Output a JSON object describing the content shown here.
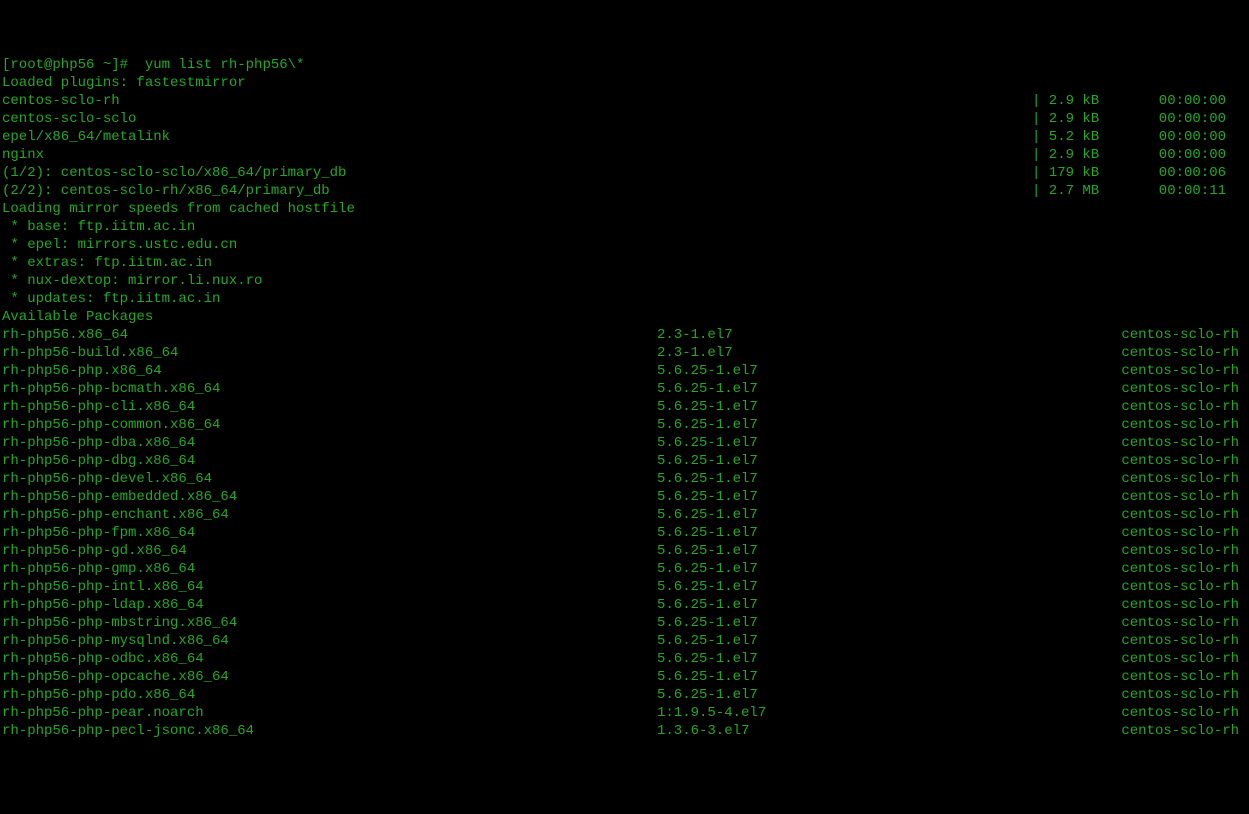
{
  "prompt": "[root@php56 ~]#  yum list rh-php56\\*",
  "loaded": "Loaded plugins: fastestmirror",
  "repos": [
    {
      "name": "centos-sclo-rh",
      "size": "| 2.9 kB",
      "time": "  00:00:00"
    },
    {
      "name": "centos-sclo-sclo",
      "size": "| 2.9 kB",
      "time": "  00:00:00"
    },
    {
      "name": "epel/x86_64/metalink",
      "size": "| 5.2 kB",
      "time": "  00:00:00"
    },
    {
      "name": "nginx",
      "size": "| 2.9 kB",
      "time": "  00:00:00"
    },
    {
      "name": "(1/2): centos-sclo-sclo/x86_64/primary_db",
      "size": "| 179 kB",
      "time": "  00:00:06"
    },
    {
      "name": "(2/2): centos-sclo-rh/x86_64/primary_db",
      "size": "| 2.7 MB",
      "time": "  00:00:11"
    }
  ],
  "loading_mirror": "Loading mirror speeds from cached hostfile",
  "mirrors": [
    " * base: ftp.iitm.ac.in",
    " * epel: mirrors.ustc.edu.cn",
    " * extras: ftp.iitm.ac.in",
    " * nux-dextop: mirror.li.nux.ro",
    " * updates: ftp.iitm.ac.in"
  ],
  "available_header": "Available Packages",
  "packages": [
    {
      "name": "rh-php56.x86_64",
      "ver": "2.3-1.el7",
      "repo": "centos-sclo-rh"
    },
    {
      "name": "rh-php56-build.x86_64",
      "ver": "2.3-1.el7",
      "repo": "centos-sclo-rh"
    },
    {
      "name": "rh-php56-php.x86_64",
      "ver": "5.6.25-1.el7",
      "repo": "centos-sclo-rh"
    },
    {
      "name": "rh-php56-php-bcmath.x86_64",
      "ver": "5.6.25-1.el7",
      "repo": "centos-sclo-rh"
    },
    {
      "name": "rh-php56-php-cli.x86_64",
      "ver": "5.6.25-1.el7",
      "repo": "centos-sclo-rh"
    },
    {
      "name": "rh-php56-php-common.x86_64",
      "ver": "5.6.25-1.el7",
      "repo": "centos-sclo-rh"
    },
    {
      "name": "rh-php56-php-dba.x86_64",
      "ver": "5.6.25-1.el7",
      "repo": "centos-sclo-rh"
    },
    {
      "name": "rh-php56-php-dbg.x86_64",
      "ver": "5.6.25-1.el7",
      "repo": "centos-sclo-rh"
    },
    {
      "name": "rh-php56-php-devel.x86_64",
      "ver": "5.6.25-1.el7",
      "repo": "centos-sclo-rh"
    },
    {
      "name": "rh-php56-php-embedded.x86_64",
      "ver": "5.6.25-1.el7",
      "repo": "centos-sclo-rh"
    },
    {
      "name": "rh-php56-php-enchant.x86_64",
      "ver": "5.6.25-1.el7",
      "repo": "centos-sclo-rh"
    },
    {
      "name": "rh-php56-php-fpm.x86_64",
      "ver": "5.6.25-1.el7",
      "repo": "centos-sclo-rh"
    },
    {
      "name": "rh-php56-php-gd.x86_64",
      "ver": "5.6.25-1.el7",
      "repo": "centos-sclo-rh"
    },
    {
      "name": "rh-php56-php-gmp.x86_64",
      "ver": "5.6.25-1.el7",
      "repo": "centos-sclo-rh"
    },
    {
      "name": "rh-php56-php-intl.x86_64",
      "ver": "5.6.25-1.el7",
      "repo": "centos-sclo-rh"
    },
    {
      "name": "rh-php56-php-ldap.x86_64",
      "ver": "5.6.25-1.el7",
      "repo": "centos-sclo-rh"
    },
    {
      "name": "rh-php56-php-mbstring.x86_64",
      "ver": "5.6.25-1.el7",
      "repo": "centos-sclo-rh"
    },
    {
      "name": "rh-php56-php-mysqlnd.x86_64",
      "ver": "5.6.25-1.el7",
      "repo": "centos-sclo-rh"
    },
    {
      "name": "rh-php56-php-odbc.x86_64",
      "ver": "5.6.25-1.el7",
      "repo": "centos-sclo-rh"
    },
    {
      "name": "rh-php56-php-opcache.x86_64",
      "ver": "5.6.25-1.el7",
      "repo": "centos-sclo-rh"
    },
    {
      "name": "rh-php56-php-pdo.x86_64",
      "ver": "5.6.25-1.el7",
      "repo": "centos-sclo-rh"
    },
    {
      "name": "rh-php56-php-pear.noarch",
      "ver": "1:1.9.5-4.el7",
      "repo": "centos-sclo-rh"
    },
    {
      "name": "rh-php56-php-pecl-jsonc.x86_64",
      "ver": "1.3.6-3.el7",
      "repo": "centos-sclo-rh"
    }
  ]
}
